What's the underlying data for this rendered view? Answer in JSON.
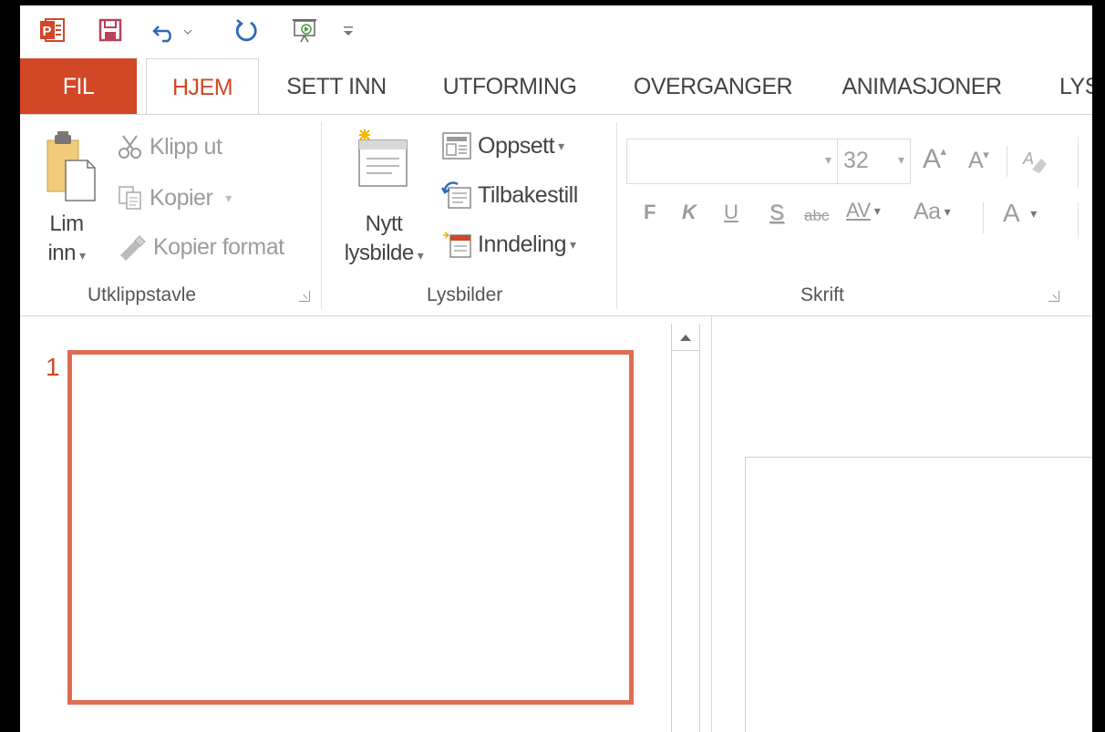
{
  "app": {
    "accent": "#d24726"
  },
  "qat": {
    "icons": [
      "powerpoint-logo-icon",
      "save-icon",
      "undo-icon",
      "redo-icon",
      "start-slideshow-icon",
      "customize-qat-icon"
    ]
  },
  "tabs": [
    {
      "label": "FIL",
      "state": "file"
    },
    {
      "label": "HJEM",
      "state": "active"
    },
    {
      "label": "SETT INN",
      "state": "normal"
    },
    {
      "label": "UTFORMING",
      "state": "normal"
    },
    {
      "label": "OVERGANGER",
      "state": "normal"
    },
    {
      "label": "ANIMASJONER",
      "state": "normal"
    },
    {
      "label": "LYS",
      "state": "normal"
    }
  ],
  "ribbon": {
    "clipboard": {
      "paste_line1": "Lim",
      "paste_line2": "inn",
      "cut": "Klipp ut",
      "copy": "Kopier",
      "format_painter": "Kopier format",
      "group_label": "Utklippstavle"
    },
    "slides": {
      "new_slide_line1": "Nytt",
      "new_slide_line2": "lysbilde",
      "layout": "Oppsett",
      "reset": "Tilbakestill",
      "section": "Inndeling",
      "group_label": "Lysbilder"
    },
    "font": {
      "font_name": "",
      "font_size": "32",
      "grow": "A",
      "shrink": "A",
      "bold": "F",
      "italic": "K",
      "underline": "U",
      "shadow": "S",
      "strikethrough": "abc",
      "spacing": "AV",
      "change_case": "Aa",
      "font_color": "A",
      "group_label": "Skrift"
    }
  },
  "slides_panel": {
    "slide_number": "1",
    "selected_border_color": "#e06b55"
  }
}
